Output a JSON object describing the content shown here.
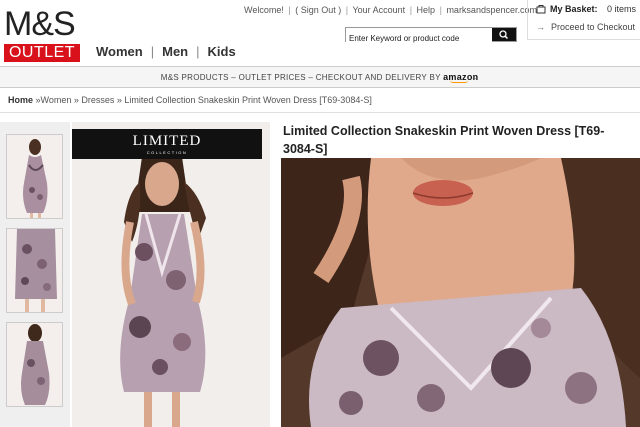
{
  "brand": {
    "logo_text": "M&S",
    "outlet_label": "OUTLET"
  },
  "top_nav": {
    "welcome": "Welcome!",
    "sign_out": "( Sign Out )",
    "account": "Your Account",
    "help": "Help",
    "site": "marksandspencer.com"
  },
  "basket": {
    "label": "My Basket:",
    "count": "0 items",
    "checkout": "Proceed to Checkout"
  },
  "search": {
    "placeholder": "Enter Keyword or product code"
  },
  "main_nav": {
    "items": [
      "Women",
      "Men",
      "Kids"
    ]
  },
  "promo": {
    "text": "M&S PRODUCTS  –  OUTLET PRICES  –  CHECKOUT AND DELIVERY BY",
    "partner": "amazon",
    "arrow": "→"
  },
  "breadcrumb": {
    "home": "Home",
    "trail": " »Women » Dresses » Limited Collection Snakeskin Print Woven Dress [T69-3084-S]"
  },
  "product": {
    "title": "Limited Collection Snakeskin Print Woven Dress [T69-3084-S]",
    "banner_title": "LIMITED",
    "banner_sub": "COLLECTION"
  },
  "colors": {
    "brand_red": "#d8111b",
    "amazon_orange": "#ff9900"
  }
}
